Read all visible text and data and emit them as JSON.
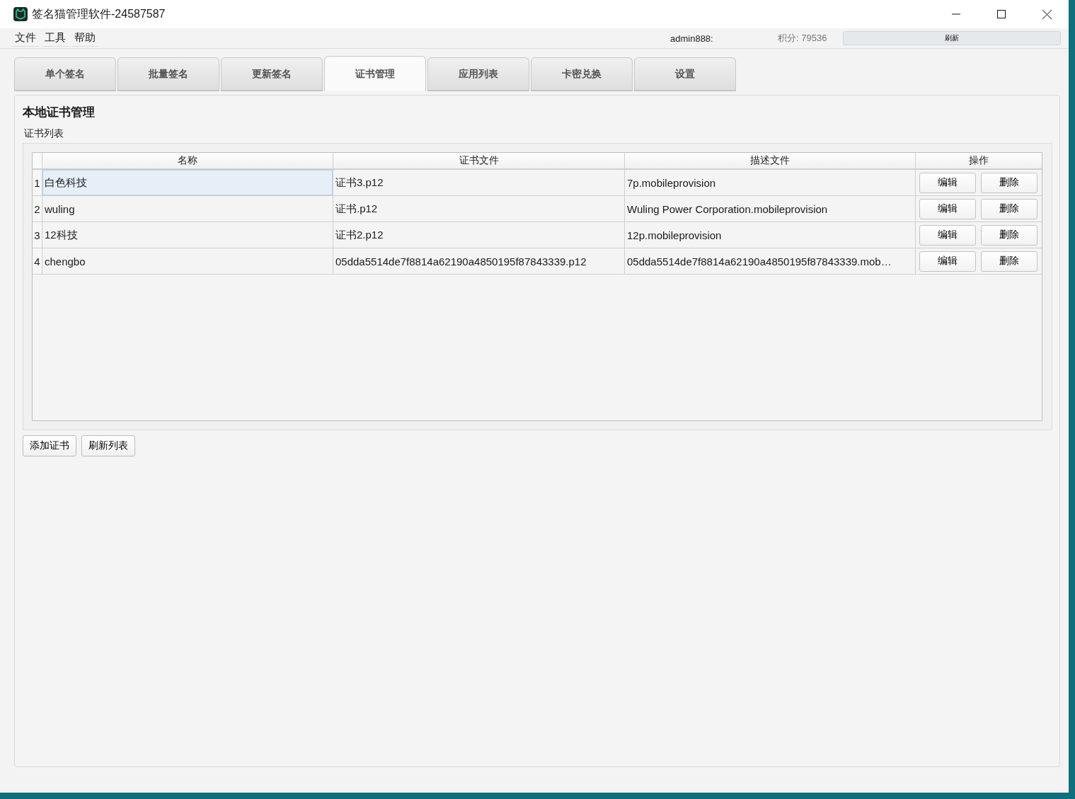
{
  "window": {
    "title": "签名猫管理软件-24587587"
  },
  "menu": [
    "文件",
    "工具",
    "帮助"
  ],
  "account": {
    "user": "admin888:",
    "points": "积分: 79536",
    "refresh_button": "刷新"
  },
  "tabs": [
    {
      "label": "单个签名",
      "selected": false
    },
    {
      "label": "批量签名",
      "selected": false
    },
    {
      "label": "更新签名",
      "selected": false
    },
    {
      "label": "证书管理",
      "selected": true
    },
    {
      "label": "应用列表",
      "selected": false
    },
    {
      "label": "卡密兑换",
      "selected": false
    },
    {
      "label": "设置",
      "selected": false
    }
  ],
  "panel": {
    "title": "本地证书管理",
    "group_label": "证书列表"
  },
  "table": {
    "columns": [
      "名称",
      "证书文件",
      "描述文件",
      "操作"
    ],
    "rows": [
      {
        "number": "1",
        "name": "白色科技",
        "cert_file": "证书3.p12",
        "profile": "7p.mobileprovision",
        "actions": [
          "编辑",
          "删除"
        ],
        "selected": true
      },
      {
        "number": "2",
        "name": "wuling",
        "cert_file": "证书.p12",
        "profile": "Wuling Power Corporation.mobileprovision",
        "actions": [
          "编辑",
          "删除"
        ],
        "selected": false
      },
      {
        "number": "3",
        "name": "12科技",
        "cert_file": "证书2.p12",
        "profile": "12p.mobileprovision",
        "actions": [
          "编辑",
          "删除"
        ],
        "selected": false
      },
      {
        "number": "4",
        "name": "chengbo",
        "cert_file": "05dda5514de7f8814a62190a4850195f87843339.p12",
        "profile": "05dda5514de7f8814a62190a4850195f87843339.mob…",
        "actions": [
          "编辑",
          "删除"
        ],
        "selected": false
      }
    ]
  },
  "buttons": [
    "添加证书",
    "刷新列表"
  ]
}
